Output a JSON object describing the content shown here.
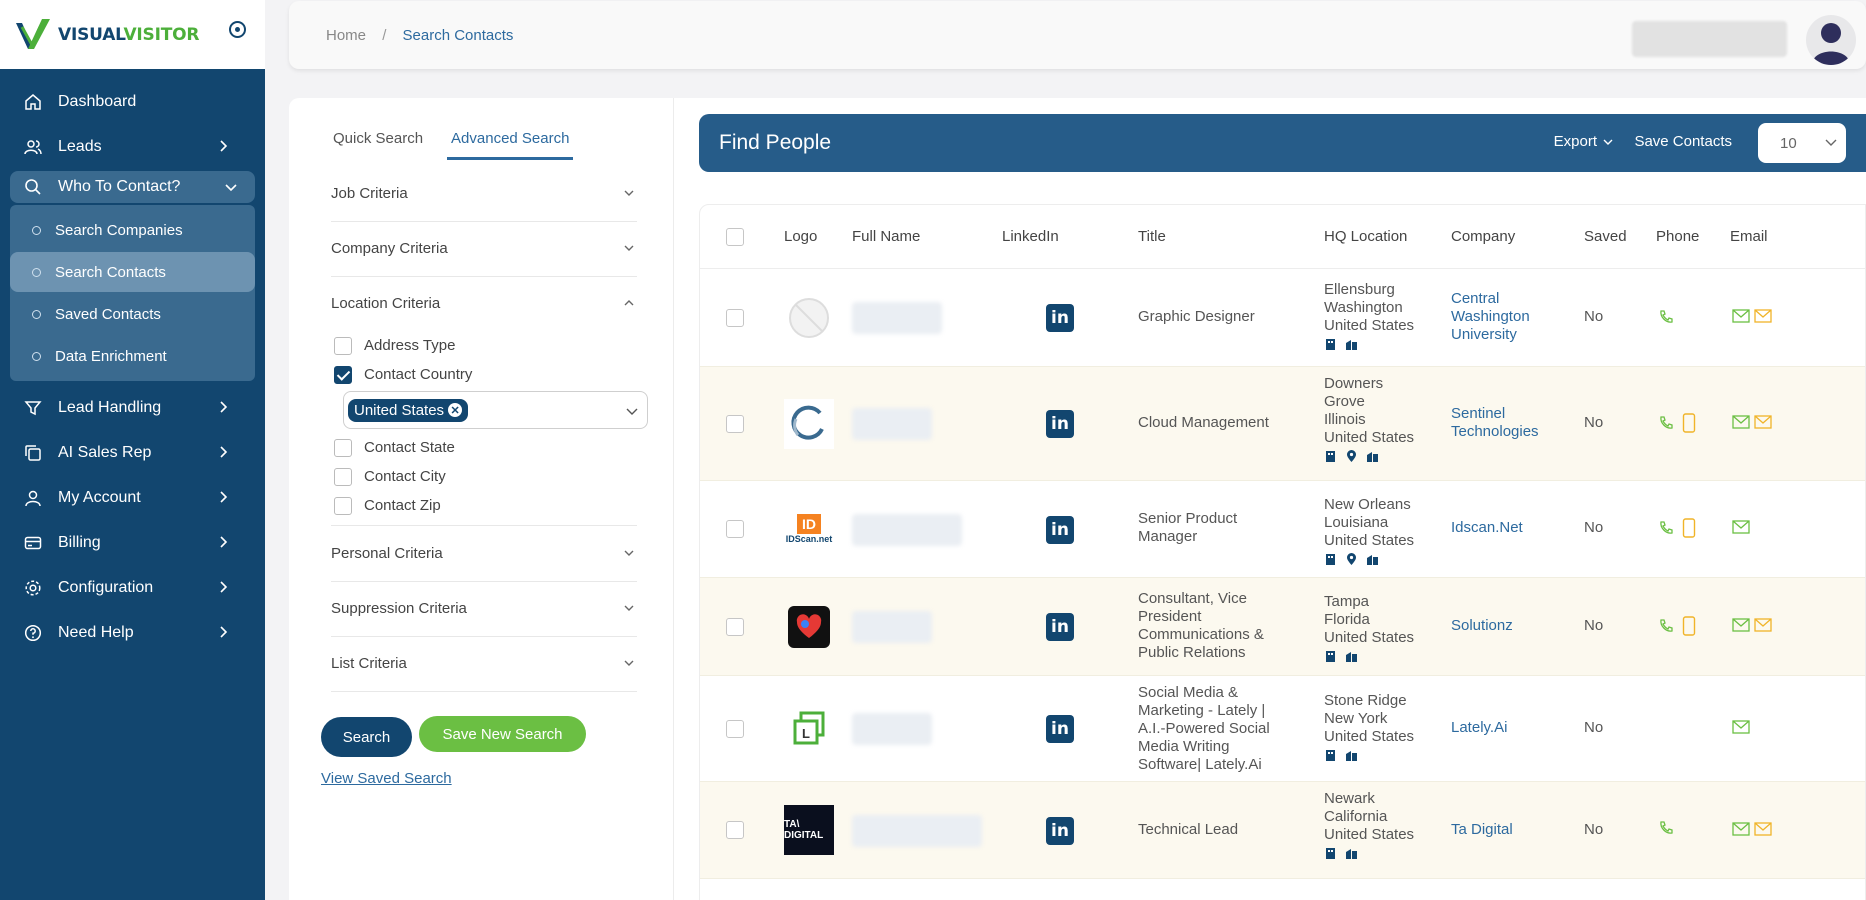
{
  "brand": {
    "part1": "VISUAL",
    "part2": "VISITOR",
    "green": "#4caf3a",
    "navy": "#12466f"
  },
  "sidebar": {
    "items": [
      {
        "label": "Dashboard",
        "icon": "home-icon"
      },
      {
        "label": "Leads",
        "icon": "users-icon"
      },
      {
        "label": "Who To Contact?",
        "icon": "search-icon"
      },
      {
        "label": "Lead Handling",
        "icon": "funnel-icon"
      },
      {
        "label": "AI Sales Rep",
        "icon": "copy-icon"
      },
      {
        "label": "My Account",
        "icon": "user-icon"
      },
      {
        "label": "Billing",
        "icon": "card-icon"
      },
      {
        "label": "Configuration",
        "icon": "gear-icon"
      },
      {
        "label": "Need Help",
        "icon": "help-icon"
      }
    ],
    "submenu": [
      {
        "label": "Search Companies"
      },
      {
        "label": "Search Contacts"
      },
      {
        "label": "Saved Contacts"
      },
      {
        "label": "Data Enrichment"
      }
    ]
  },
  "breadcrumb": {
    "home": "Home",
    "separator": "/",
    "current": "Search Contacts"
  },
  "filters": {
    "tabs": [
      "Quick Search",
      "Advanced Search"
    ],
    "sections": {
      "job": "Job Criteria",
      "company": "Company Criteria",
      "location": "Location Criteria",
      "personal": "Personal Criteria",
      "suppression": "Suppression Criteria",
      "list": "List Criteria"
    },
    "location_options": {
      "address_type": "Address Type",
      "contact_country": "Contact Country",
      "contact_state": "Contact State",
      "contact_city": "Contact City",
      "contact_zip": "Contact Zip"
    },
    "country_chip": "United States",
    "search_button": "Search",
    "save_new_search_button": "Save New Search",
    "view_saved_search": "View Saved Search"
  },
  "results": {
    "title": "Find People",
    "export": "Export",
    "save_contacts": "Save Contacts",
    "page_size": "10",
    "columns": {
      "logo": "Logo",
      "full_name": "Full Name",
      "linkedin": "LinkedIn",
      "title": "Title",
      "hq_location": "HQ Location",
      "company": "Company",
      "saved": "Saved",
      "phone": "Phone",
      "email": "Email"
    },
    "rows": [
      {
        "title": "Graphic Designer",
        "hq": [
          "Ellensburg",
          "Washington",
          "United States"
        ],
        "company": "Central Washington University",
        "saved": "No"
      },
      {
        "title": "Cloud Management",
        "hq": [
          "Downers Grove",
          "Illinois",
          "United States"
        ],
        "company": "Sentinel Technologies",
        "saved": "No"
      },
      {
        "title": "Senior Product Manager",
        "hq": [
          "New Orleans",
          "Louisiana",
          "United States"
        ],
        "company": "Idscan.Net",
        "saved": "No"
      },
      {
        "title": "Consultant, Vice President Communications & Public Relations",
        "hq": [
          "Tampa",
          "Florida",
          "United States"
        ],
        "company": "Solutionz",
        "saved": "No"
      },
      {
        "title": "Social Media & Marketing - Lately | A.I.-Powered Social Media Writing Software| Lately.Ai",
        "hq": [
          "Stone Ridge",
          "New York",
          "United States"
        ],
        "company": "Lately.Ai",
        "saved": "No"
      },
      {
        "title": "Technical Lead",
        "hq": [
          "Newark",
          "California",
          "United States"
        ],
        "company": "Ta Digital",
        "saved": "No"
      }
    ],
    "logo_text": {
      "idscan_badge": "ID",
      "idscan_name": "IDScan.net",
      "ta": "TA\\ DIGITAL",
      "lately": "L"
    }
  }
}
